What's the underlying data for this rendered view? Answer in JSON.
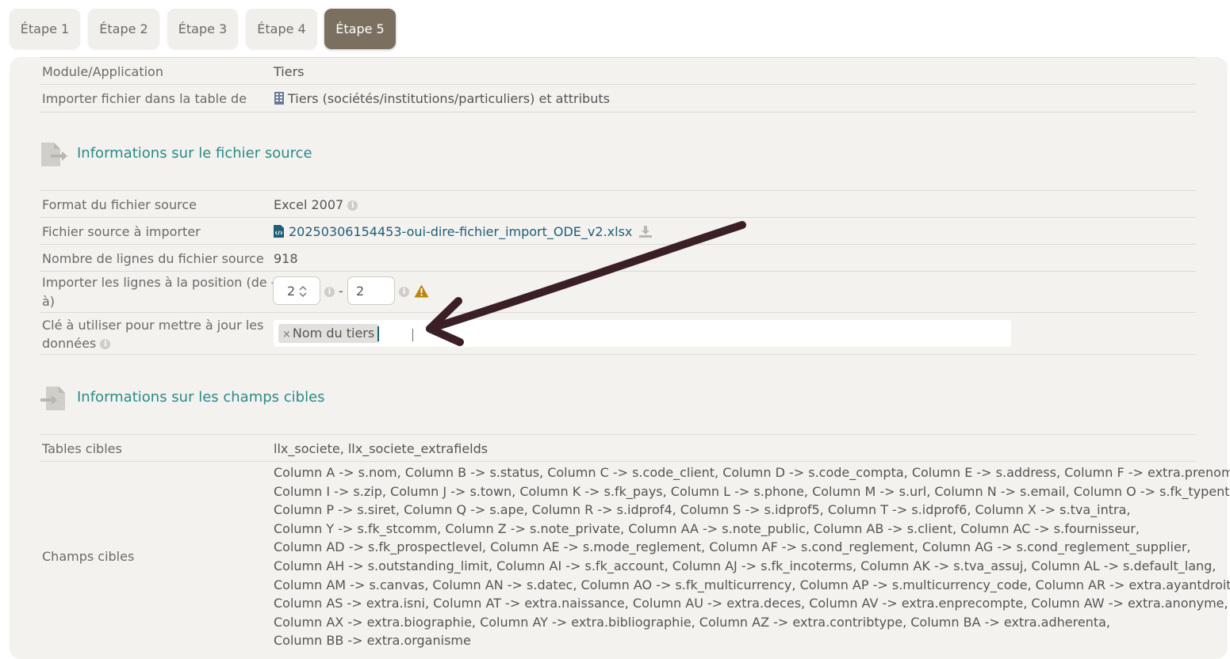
{
  "tabs": [
    "Étape 1",
    "Étape 2",
    "Étape 3",
    "Étape 4",
    "Étape 5"
  ],
  "active_tab": "Étape 5",
  "top_rows": [
    {
      "label": "Module/Application",
      "value": "Tiers"
    },
    {
      "label": "Importer fichier dans la table de",
      "value": "Tiers (sociétés/institutions/particuliers) et attributs"
    }
  ],
  "section_source": {
    "title": "Informations sur le fichier source"
  },
  "source_rows": {
    "format": {
      "label": "Format du fichier source",
      "value": "Excel 2007"
    },
    "file": {
      "label": "Fichier source à importer",
      "value": "20250306154453-oui-dire-fichier_import_ODE_v2.xlsx"
    },
    "lines": {
      "label": "Nombre de lignes du fichier source",
      "value": "918"
    },
    "range": {
      "label_1": "Importer les lignes à la position (de -",
      "label_2": "à)",
      "from": "2",
      "separator": "-",
      "to": "2"
    },
    "key": {
      "label_1": "Clé à utiliser pour mettre à jour les",
      "label_2": "données",
      "chip_remove": "×",
      "chip": "Nom du tiers"
    }
  },
  "section_target": {
    "title": "Informations sur les champs cibles"
  },
  "target_rows": {
    "tables": {
      "label": "Tables cibles",
      "value": "llx_societe, llx_societe_extrafields"
    },
    "fields": {
      "label": "Champs cibles",
      "lines": [
        "Column A -> s.nom, Column B -> s.status, Column C -> s.code_client, Column D -> s.code_compta, Column E -> s.address, Column F -> extra.prenom,",
        "Column I -> s.zip, Column J -> s.town, Column K -> s.fk_pays, Column L -> s.phone, Column M -> s.url, Column N -> s.email, Column O -> s.fk_typent,",
        "Column P -> s.siret, Column Q -> s.ape, Column R -> s.idprof4, Column S -> s.idprof5, Column T -> s.idprof6, Column X -> s.tva_intra,",
        "Column Y -> s.fk_stcomm, Column Z -> s.note_private, Column AA -> s.note_public, Column AB -> s.client, Column AC -> s.fournisseur,",
        "Column AD -> s.fk_prospectlevel, Column AE -> s.mode_reglement, Column AF -> s.cond_reglement, Column AG -> s.cond_reglement_supplier,",
        "Column AH -> s.outstanding_limit, Column AI -> s.fk_account, Column AJ -> s.fk_incoterms, Column AK -> s.tva_assuj, Column AL -> s.default_lang,",
        "Column AM -> s.canvas, Column AN -> s.datec, Column AO -> s.fk_multicurrency, Column AP -> s.multicurrency_code, Column AR -> extra.ayantdroitdirect,",
        "Column AS -> extra.isni, Column AT -> extra.naissance, Column AU -> extra.deces, Column AV -> extra.enprecompte, Column AW -> extra.anonyme,",
        "Column AX -> extra.biographie, Column AY -> extra.bibliographie, Column AZ -> extra.contribtype, Column BA -> extra.adherenta,",
        "Column BB -> extra.organisme"
      ]
    }
  },
  "colors": {
    "accent": "#7b6f60",
    "section_title": "#2a8a8a",
    "link": "#1f5e78",
    "panel": "#f4f2ee",
    "arrow": "#3a1f26",
    "warning": "#b8860b"
  }
}
